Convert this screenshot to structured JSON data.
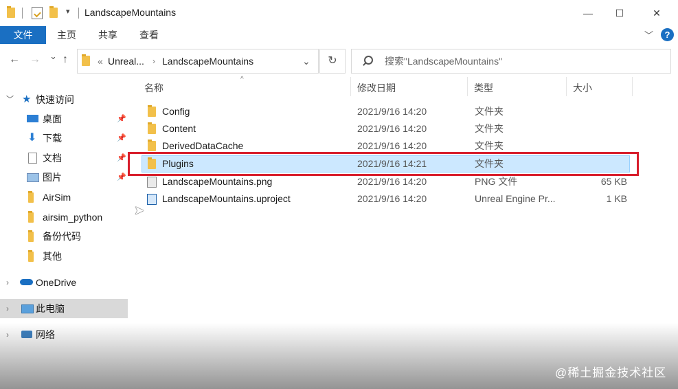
{
  "window": {
    "title": "LandscapeMountains",
    "controls": {
      "minimize": "—",
      "maximize": "☐",
      "close": "✕"
    }
  },
  "ribbon": {
    "file_tab": "文件",
    "tabs": [
      "主页",
      "共享",
      "查看"
    ],
    "help": "?"
  },
  "nav": {
    "back": "←",
    "forward": "→",
    "recent": "⌄",
    "up": "↑",
    "breadcrumb_overflow": "«",
    "breadcrumb": [
      "Unreal...",
      "LandscapeMountains"
    ],
    "address_dropdown": "⌄",
    "refresh": "↻",
    "search_placeholder": "搜索\"LandscapeMountains\""
  },
  "sidebar": {
    "quick_access": "快速访问",
    "items": [
      {
        "label": "桌面",
        "pinned": true,
        "icon": "desktop-icon"
      },
      {
        "label": "下载",
        "pinned": true,
        "icon": "download-icon"
      },
      {
        "label": "文档",
        "pinned": true,
        "icon": "document-icon"
      },
      {
        "label": "图片",
        "pinned": true,
        "icon": "picture-icon"
      },
      {
        "label": "AirSim",
        "pinned": false,
        "icon": "folder-icon"
      },
      {
        "label": "airsim_python",
        "pinned": false,
        "icon": "folder-icon"
      },
      {
        "label": "备份代码",
        "pinned": false,
        "icon": "folder-icon"
      },
      {
        "label": "其他",
        "pinned": false,
        "icon": "folder-icon"
      }
    ],
    "onedrive": "OneDrive",
    "this_pc": "此电脑",
    "network": "网络"
  },
  "columns": {
    "name": "名称",
    "modified": "修改日期",
    "type": "类型",
    "size": "大小"
  },
  "files": [
    {
      "name": "Config",
      "modified": "2021/9/16 14:20",
      "type": "文件夹",
      "size": "",
      "icon": "folder-icon"
    },
    {
      "name": "Content",
      "modified": "2021/9/16 14:20",
      "type": "文件夹",
      "size": "",
      "icon": "folder-icon"
    },
    {
      "name": "DerivedDataCache",
      "modified": "2021/9/16 14:20",
      "type": "文件夹",
      "size": "",
      "icon": "folder-icon"
    },
    {
      "name": "Plugins",
      "modified": "2021/9/16 14:21",
      "type": "文件夹",
      "size": "",
      "icon": "folder-icon"
    },
    {
      "name": "LandscapeMountains.png",
      "modified": "2021/9/16 14:20",
      "type": "PNG 文件",
      "size": "65 KB",
      "icon": "image-file-icon"
    },
    {
      "name": "LandscapeMountains.uproject",
      "modified": "2021/9/16 14:20",
      "type": "Unreal Engine Pr...",
      "size": "1 KB",
      "icon": "uproject-file-icon"
    }
  ],
  "watermark": "@稀土掘金技术社区",
  "colors": {
    "accent": "#1a6fc2",
    "selection": "#cce8ff",
    "highlight_box": "#d81e2c",
    "folder": "#f2c04a"
  }
}
